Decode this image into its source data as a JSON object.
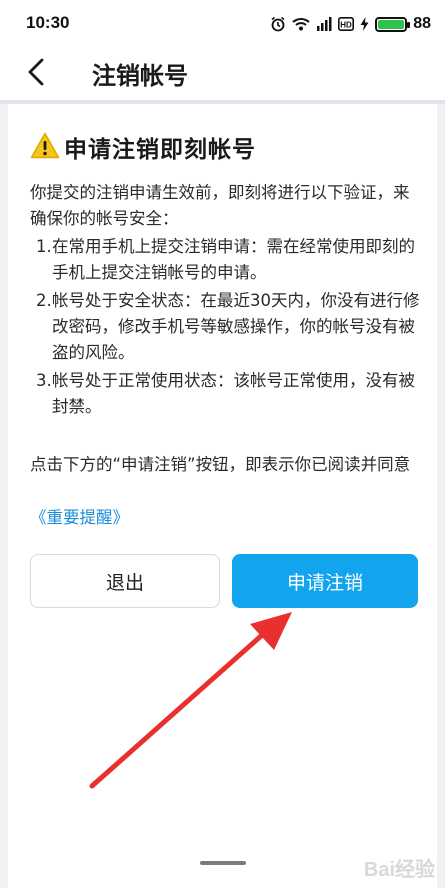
{
  "status_bar": {
    "time": "10:30",
    "battery_level": "88",
    "battery_color": "#2ec24a",
    "icons": [
      "alarm-icon",
      "wifi-icon",
      "signal-4g-icon",
      "hd-icon",
      "charging-icon",
      "battery-icon"
    ]
  },
  "header": {
    "back_icon": "chevron-left-icon",
    "title": "注销帐号"
  },
  "main": {
    "warning_icon": "warning-triangle-icon",
    "heading": "申请注销即刻帐号",
    "intro": "你提交的注销申请生效前，即刻将进行以下验证，来确保你的帐号安全：",
    "conditions": [
      {
        "num": "1.",
        "text": "在常用手机上提交注销申请：需在经常使用即刻的手机上提交注销帐号的申请。"
      },
      {
        "num": "2.",
        "text": "帐号处于安全状态：在最近30天内，你没有进行修改密码，修改手机号等敏感操作，你的帐号没有被盗的风险。"
      },
      {
        "num": "3.",
        "text": "帐号处于正常使用状态：该帐号正常使用，没有被封禁。"
      }
    ],
    "notice": "点击下方的“申请注销”按钮，即表示你已阅读并同意",
    "link": "《重要提醒》",
    "exit_button": "退出",
    "apply_button": "申请注销",
    "accent_color": "#12a5ee",
    "link_color": "#1a8ed9"
  },
  "annotation": {
    "arrow_color": "#e8302f"
  },
  "watermark": "Bai经验"
}
